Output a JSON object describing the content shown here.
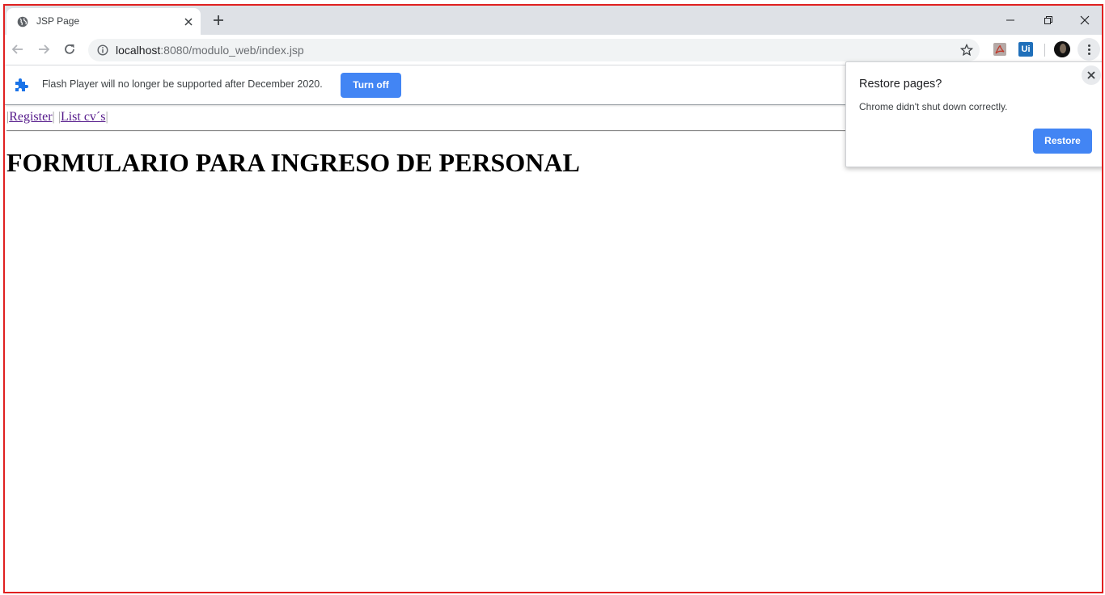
{
  "browser": {
    "tab_title": "JSP Page",
    "url_host": "localhost",
    "url_rest": ":8080/modulo_web/index.jsp",
    "extensions": [
      "adobe-pdf-icon",
      "uipath-icon"
    ],
    "ext_ui_label": "Ui"
  },
  "infobar": {
    "message": "Flash Player will no longer be supported after December 2020.",
    "button": "Turn off"
  },
  "page": {
    "link_register": "Register",
    "link_list": "List cv´s",
    "heading": "FORMULARIO PARA INGRESO DE PERSONAL"
  },
  "restore_bubble": {
    "title": "Restore pages?",
    "message": "Chrome didn't shut down correctly.",
    "button": "Restore"
  },
  "colors": {
    "accent": "#4285f4",
    "frame_border": "#e02020",
    "visited_link": "#551a8b"
  }
}
